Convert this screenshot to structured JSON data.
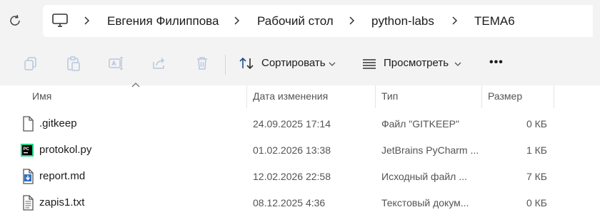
{
  "address_bar": {
    "breadcrumbs": [
      "Евгения Филиппова",
      "Рабочий стол",
      "python-labs",
      "TEMA6"
    ]
  },
  "toolbar": {
    "sort_label": "Сортировать",
    "view_label": "Просмотреть",
    "more_label": "•••"
  },
  "columns": {
    "name": "Имя",
    "date": "Дата изменения",
    "type": "Тип",
    "size": "Размер"
  },
  "files": [
    {
      "name": ".gitkeep",
      "date": "24.09.2025 17:14",
      "type": "Файл \"GITKEEP\"",
      "size": "0 КБ",
      "icon": "blank-file-icon"
    },
    {
      "name": "protokol.py",
      "date": "01.02.2026 13:38",
      "type": "JetBrains PyCharm ...",
      "size": "1 КБ",
      "icon": "pycharm-file-icon"
    },
    {
      "name": "report.md",
      "date": "12.02.2026 22:58",
      "type": "Исходный файл ...",
      "size": "7 КБ",
      "icon": "markdown-file-icon"
    },
    {
      "name": "zapis1.txt",
      "date": "08.12.2025 4:36",
      "type": "Текстовый докум...",
      "size": "0 КБ",
      "icon": "text-file-icon"
    }
  ]
}
